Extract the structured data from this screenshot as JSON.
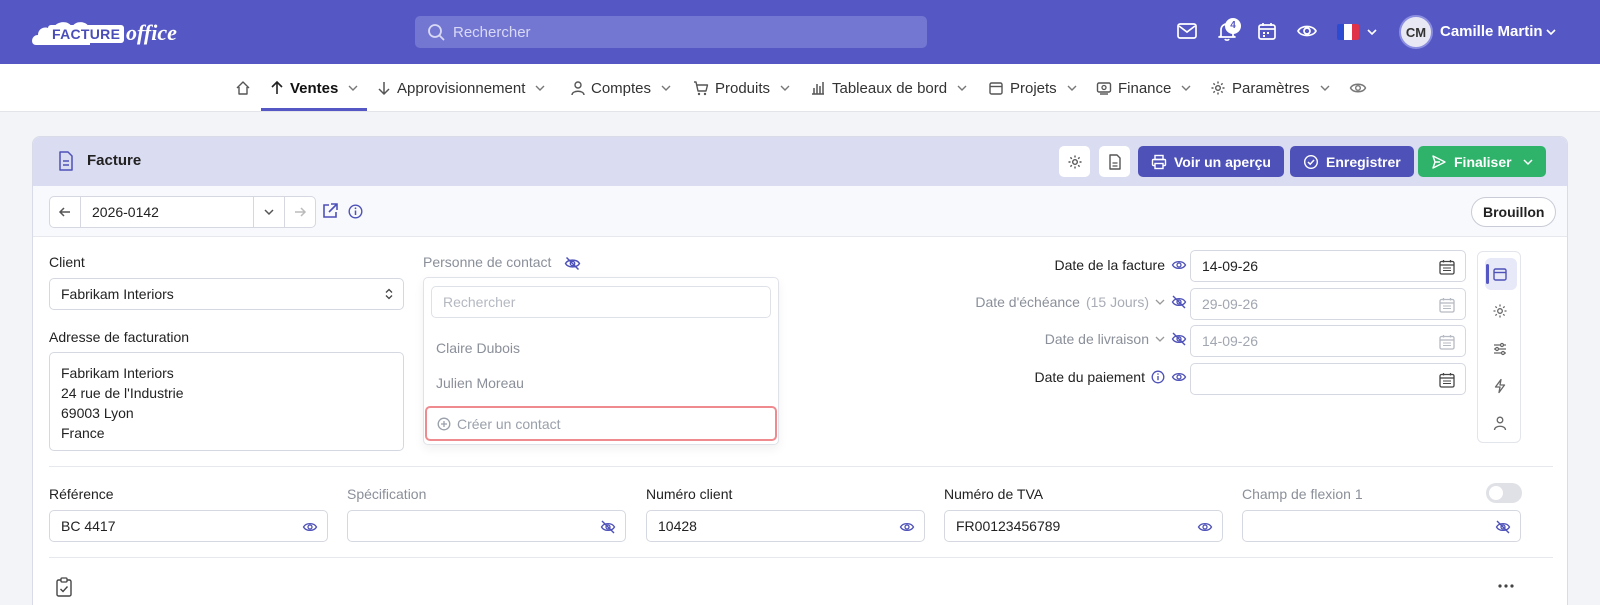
{
  "app": {
    "logo_part1": "FACTURE",
    "logo_part2": "office",
    "search_placeholder": "Rechercher",
    "notifications_count": "4",
    "user_initials": "CM",
    "user_name": "Camille Martin",
    "accent_color": "#5558c4"
  },
  "nav": {
    "items": [
      {
        "label": "Ventes",
        "icon": "arrow-up-icon"
      },
      {
        "label": "Approvisionnement",
        "icon": "arrow-down-icon"
      },
      {
        "label": "Comptes",
        "icon": "user-icon"
      },
      {
        "label": "Produits",
        "icon": "cart-icon"
      },
      {
        "label": "Tableaux de bord",
        "icon": "bar-chart-icon"
      },
      {
        "label": "Projets",
        "icon": "calendar-icon"
      },
      {
        "label": "Finance",
        "icon": "money-icon"
      },
      {
        "label": "Paramètres",
        "icon": "gear-icon"
      }
    ],
    "active": "Ventes"
  },
  "card": {
    "title": "Facture",
    "preview_label": "Voir un aperçu",
    "save_label": "Enregistrer",
    "finalize_label": "Finaliser",
    "invoice_number": "2026-0142",
    "status": "Brouillon"
  },
  "form": {
    "client_label": "Client",
    "client_value": "Fabrikam Interiors",
    "billing_label": "Adresse de facturation",
    "billing_lines": [
      "Fabrikam Interiors",
      "24 rue de l'Industrie",
      "69003 Lyon",
      "France"
    ],
    "contact_label": "Personne de contact",
    "contact_search_placeholder": "Rechercher",
    "contacts": [
      "Claire Dubois",
      "Julien Moreau"
    ],
    "create_contact": "Créer un contact",
    "invoice_date_label": "Date de la facture",
    "invoice_date_value": "14-09-26",
    "due_date_label": "Date d'échéance",
    "due_date_hint": "(15 Jours)",
    "due_date_value": "29-09-26",
    "delivery_date_label": "Date de livraison",
    "delivery_date_value": "14-09-26",
    "payment_date_label": "Date du paiement",
    "payment_date_value": "",
    "reference_label": "Référence",
    "reference_value": "BC 4417",
    "specification_label": "Spécification",
    "specification_value": "",
    "client_number_label": "Numéro client",
    "client_number_value": "10428",
    "vat_label": "Numéro de TVA",
    "vat_value": "FR00123456789",
    "flex_label": "Champ de flexion 1",
    "flex_value": ""
  }
}
